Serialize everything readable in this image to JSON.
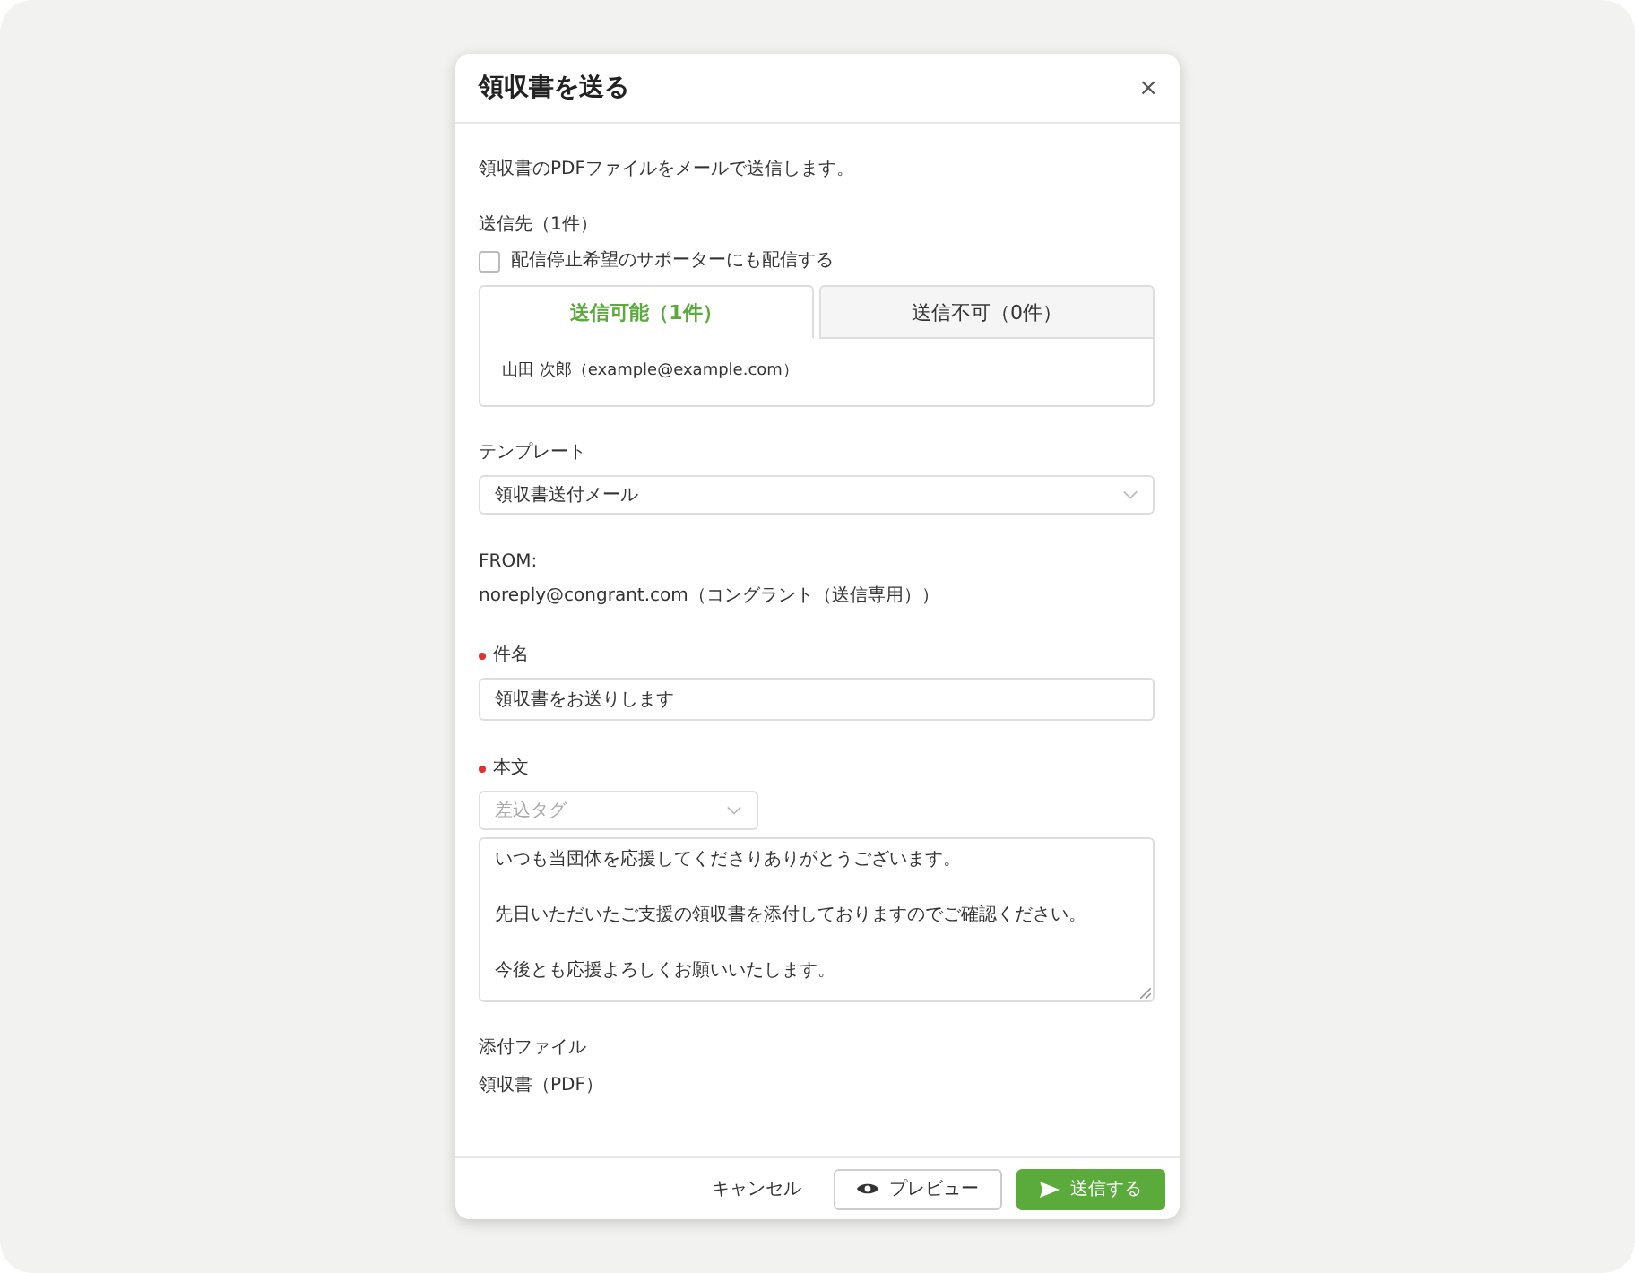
{
  "dialog": {
    "title": "領収書を送る",
    "close": "×",
    "description": "領収書のPDFファイルをメールで送信します。",
    "recipients": {
      "label": "送信先（1件）",
      "checkbox": {
        "label": "配信停止希望のサポーターにも配信する",
        "checked": false
      },
      "tabs": [
        {
          "label": "送信可能（1件）",
          "selected": true
        },
        {
          "label": "送信不可（0件）",
          "selected": false
        }
      ],
      "list": [
        "山田 次郎（example@example.com）"
      ]
    },
    "template": {
      "label": "テンプレート",
      "value": "領収書送付メール"
    },
    "from": {
      "label": "FROM:",
      "value": "noreply@congrant.com（コングラント（送信専用））"
    },
    "subject": {
      "label": "件名",
      "required": true,
      "value": "領収書をお送りします"
    },
    "body": {
      "label": "本文",
      "required": true,
      "tag_select": {
        "placeholder": "差込タグ"
      },
      "paragraphs": [
        "いつも当団体を応援してくださりありがとうございます。",
        "先日いただいたご支援の領収書を添付しておりますのでご確認ください。",
        "今後とも応援よろしくお願いいたします。"
      ]
    },
    "attachment": {
      "label": "添付ファイル",
      "value": "領収書（PDF）"
    },
    "buttons": [
      {
        "label": "キャンセル",
        "kind": "text"
      },
      {
        "label": "プレビュー",
        "kind": "preview"
      },
      {
        "label": "送信する",
        "kind": "primary"
      }
    ]
  }
}
